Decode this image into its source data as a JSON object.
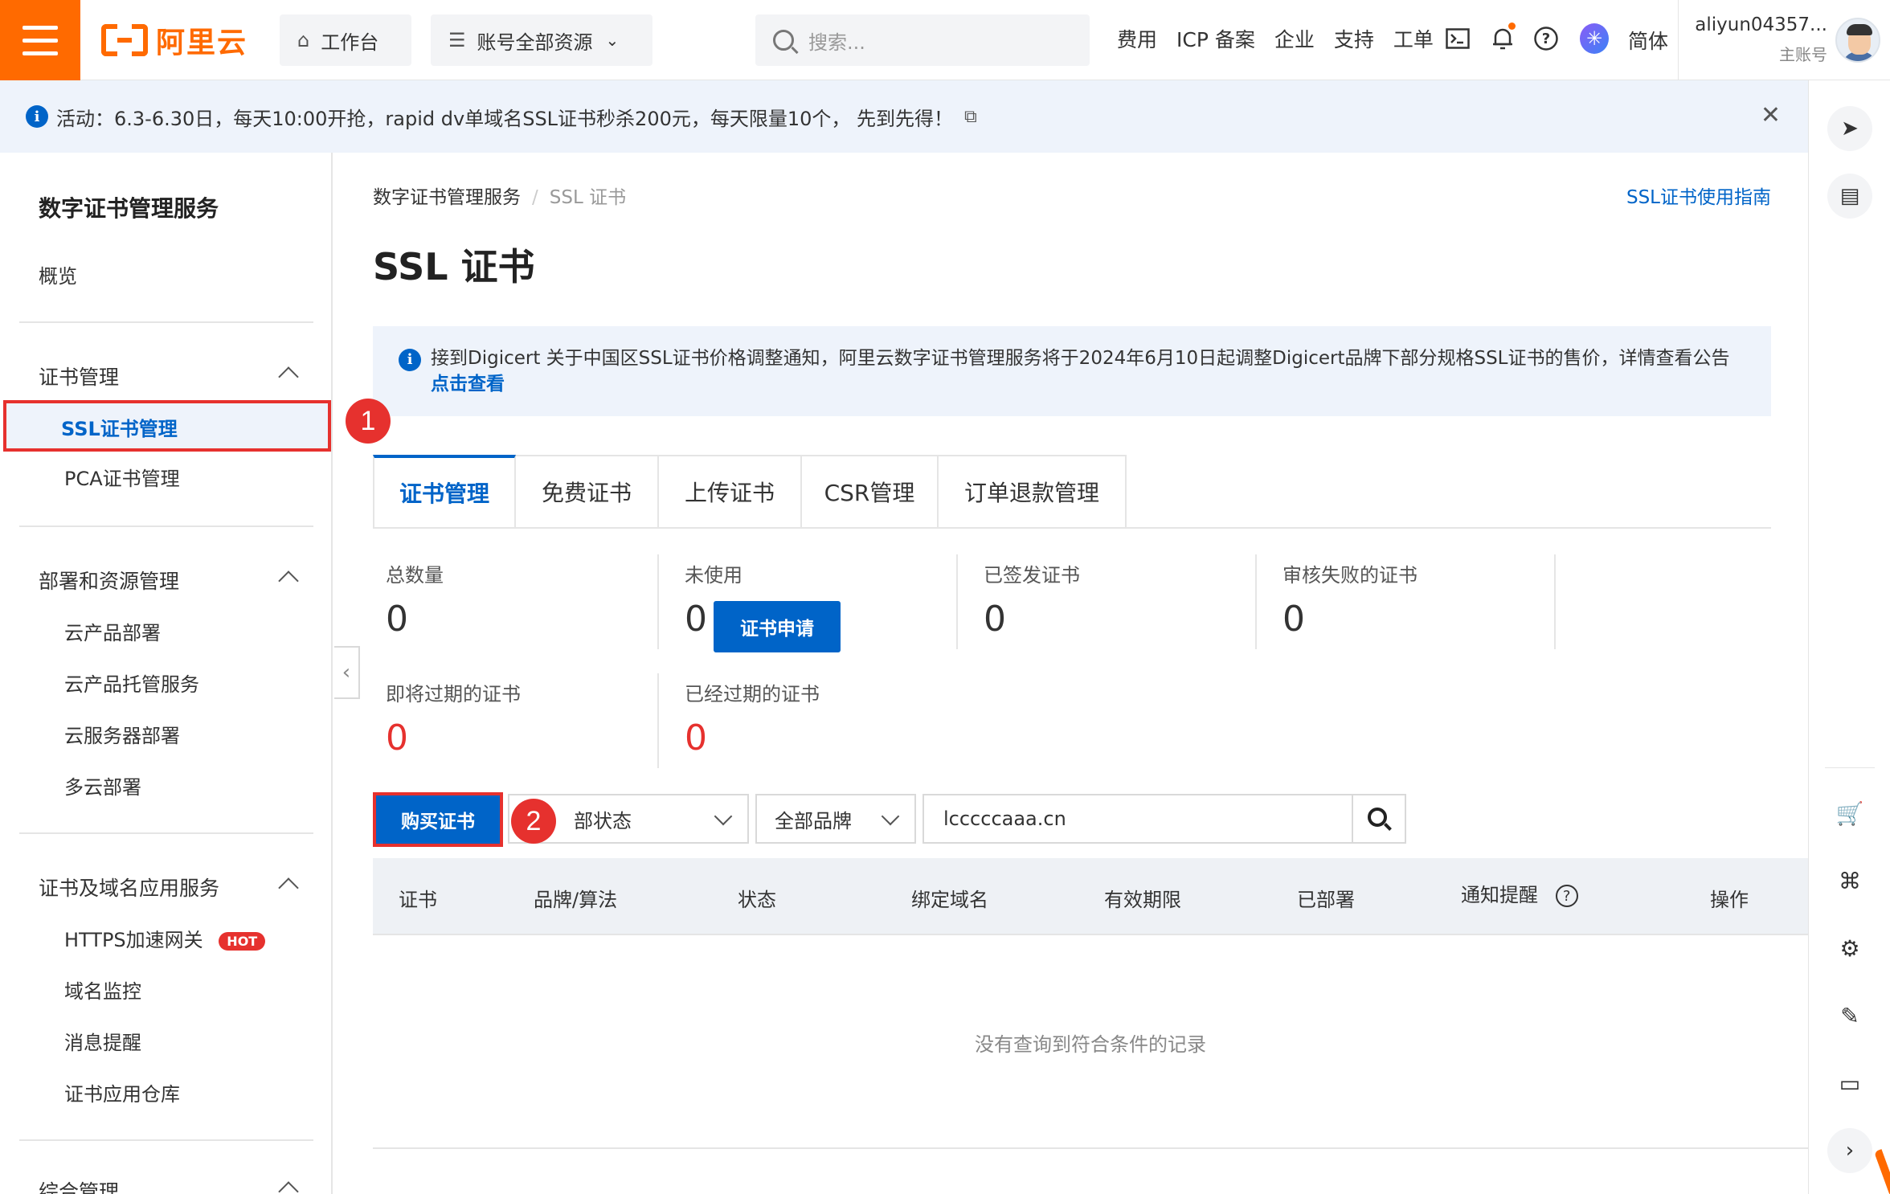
{
  "topbar": {
    "logo_text": "阿里云",
    "workbench": "工作台",
    "resources": "账号全部资源",
    "search_placeholder": "搜索...",
    "links": [
      "费用",
      "ICP 备案",
      "企业",
      "支持",
      "工单"
    ],
    "language": "简体",
    "account_name": "aliyun04357...",
    "account_role": "主账号"
  },
  "banner": {
    "text": "活动：6.3-6.30日，每天10:00开抢，rapid dv单域名SSL证书秒杀200元，每天限量10个，  先到先得！"
  },
  "sidebar": {
    "title": "数字证书管理服务",
    "overview": "概览",
    "group1": "证书管理",
    "ssl_manage": "SSL证书管理",
    "pca_manage": "PCA证书管理",
    "group2": "部署和资源管理",
    "cloud_deploy": "云产品部署",
    "cloud_hosting": "云产品托管服务",
    "server_deploy": "云服务器部署",
    "multi_cloud": "多云部署",
    "group3": "证书及域名应用服务",
    "https_gateway": "HTTPS加速网关",
    "hot_badge": "HOT",
    "domain_monitor": "域名监控",
    "message_alert": "消息提醒",
    "cert_repo": "证书应用仓库",
    "group4": "综合管理"
  },
  "main": {
    "breadcrumb_root": "数字证书管理服务",
    "breadcrumb_current": "SSL 证书",
    "guide_link": "SSL证书使用指南",
    "title": "SSL 证书",
    "notice_text": "接到Digicert 关于中国区SSL证书价格调整通知，阿里云数字证书管理服务将于2024年6月10日起调整Digicert品牌下部分规格SSL证书的售价，详情查看公告",
    "notice_link": "点击查看",
    "tabs": [
      "证书管理",
      "免费证书",
      "上传证书",
      "CSR管理",
      "订单退款管理"
    ],
    "stats": {
      "total_label": "总数量",
      "total_value": "0",
      "unused_label": "未使用",
      "unused_value": "0",
      "issued_label": "已签发证书",
      "issued_value": "0",
      "failed_label": "审核失败的证书",
      "failed_value": "0",
      "expiring_label": "即将过期的证书",
      "expiring_value": "0",
      "expired_label": "已经过期的证书",
      "expired_value": "0"
    },
    "apply_button": "证书申请",
    "buy_button": "购买证书",
    "status_select": "部状态",
    "brand_select": "全部品牌",
    "search_value": "lcccccaaa.cn",
    "table_headers": [
      "证书",
      "品牌/算法",
      "状态",
      "绑定域名",
      "有效期限",
      "已部署",
      "通知提醒",
      "操作"
    ],
    "empty_text": "没有查询到符合条件的记录"
  },
  "markers": [
    "1",
    "2"
  ],
  "colors": {
    "brand": "#ff6a00",
    "primary": "#0064c8",
    "highlight": "#e6312e"
  }
}
